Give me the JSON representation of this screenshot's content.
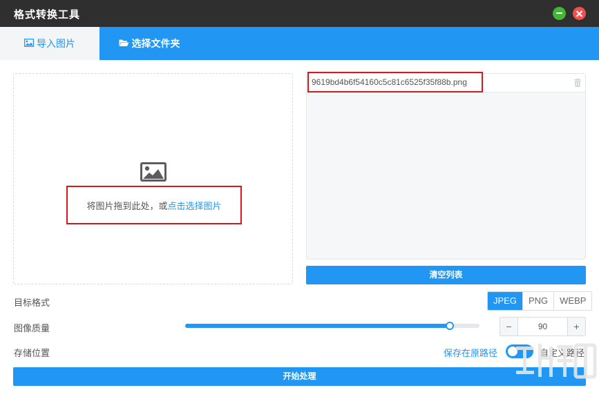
{
  "app": {
    "title": "格式转换工具"
  },
  "window_controls": {
    "minimize": "minimize",
    "close": "close"
  },
  "tabs": [
    {
      "label": "导入图片",
      "icon": "image-icon",
      "active": true
    },
    {
      "label": "选择文件夹",
      "icon": "folder-open-icon",
      "active": false
    }
  ],
  "dropzone": {
    "hint_prefix": "将图片拖到此处，或",
    "hint_link": "点击选择图片",
    "icon": "image-icon"
  },
  "file_list": {
    "items": [
      {
        "name": "9619bd4b6f54160c5c81c6525f35f88b.png"
      }
    ],
    "clear_label": "清空列表"
  },
  "settings": {
    "format_label": "目标格式",
    "formats": [
      "JPEG",
      "PNG",
      "WEBP"
    ],
    "selected_format": "JPEG",
    "quality_label": "图像质量",
    "quality_value": "90",
    "quality_fraction": 0.9,
    "storage_label": "存储位置",
    "storage_original": "保存在原路径",
    "storage_custom": "自定义路径"
  },
  "start_label": "开始处理",
  "colors": {
    "accent": "#2196f3",
    "titlebar": "#2f2f2f",
    "highlight_box": "#d9161c",
    "minimize": "#45b538",
    "close": "#f05050"
  }
}
